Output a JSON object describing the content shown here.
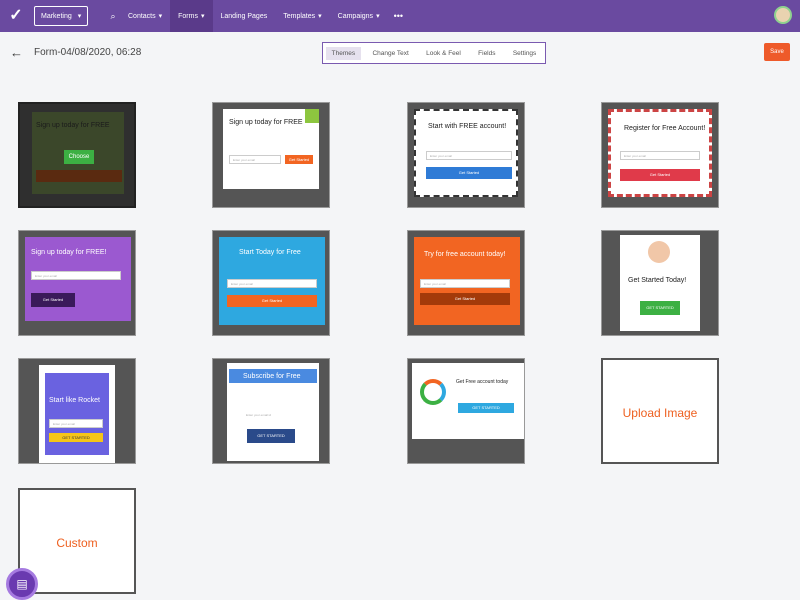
{
  "nav": {
    "workspace": "Marketing",
    "items": [
      "Contacts",
      "Forms",
      "Landing Pages",
      "Templates",
      "Campaigns"
    ],
    "active": "Forms",
    "more": "•••"
  },
  "subbar": {
    "back": "←",
    "form_title": "Form-04/08/2020, 06:28",
    "tabs": [
      "Themes",
      "Change Text",
      "Look & Feel",
      "Fields",
      "Settings"
    ],
    "save": "Save"
  },
  "themes": [
    {
      "title": "Sign up today for FREE",
      "button": "Choose"
    },
    {
      "title": "Sign up today for FREE",
      "input": "Enter your email",
      "button": "Get Started"
    },
    {
      "title": "Start with FREE account!",
      "input": "Enter your email",
      "button": "Get Started"
    },
    {
      "title": "Register for Free Account!",
      "input": "Enter your email",
      "button": "Get Started"
    },
    {
      "title": "Sign up today for FREE!",
      "input": "Enter your email",
      "button": "Get Started"
    },
    {
      "title": "Start Today for Free",
      "input": "Enter your email",
      "button": "Get Started"
    },
    {
      "title": "Try for free account today!",
      "input": "Enter your email",
      "button": "Get Started"
    },
    {
      "title": "Get Started Today!",
      "button": "GET STARTED"
    },
    {
      "title": "Start like Rocket",
      "input": "Enter your email",
      "button": "GET STARTED"
    },
    {
      "title": "Subscribe for Free",
      "input": "Enter your email id",
      "button": "GET STARTED"
    },
    {
      "title": "Get Free account today",
      "button": "GET STARTED"
    },
    {
      "title": "Upload Image"
    },
    {
      "title": "Custom"
    }
  ],
  "colors": {
    "nav": "#6a4aa0",
    "accent": "#ee5a2a",
    "label": "#ee6020"
  }
}
